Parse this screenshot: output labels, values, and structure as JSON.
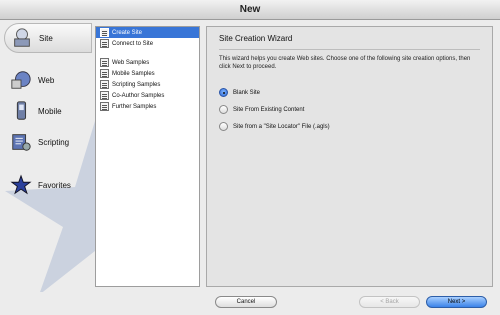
{
  "window": {
    "title": "New"
  },
  "categories": [
    {
      "label": "Site",
      "icon": "site-icon",
      "selected": true
    },
    {
      "label": "Web",
      "icon": "web-icon",
      "selected": false
    },
    {
      "label": "Mobile",
      "icon": "mobile-icon",
      "selected": false
    },
    {
      "label": "Scripting",
      "icon": "scripting-icon",
      "selected": false
    },
    {
      "label": "Favorites",
      "icon": "favorites-star-icon",
      "selected": false
    }
  ],
  "subitems": [
    {
      "label": "Create Site",
      "selected": true
    },
    {
      "label": "Connect to Site",
      "selected": false
    },
    {
      "label": "Web Samples",
      "selected": false
    },
    {
      "label": "Mobile Samples",
      "selected": false
    },
    {
      "label": "Scripting Samples",
      "selected": false
    },
    {
      "label": "Co-Author Samples",
      "selected": false
    },
    {
      "label": "Further Samples",
      "selected": false
    }
  ],
  "panel": {
    "title": "Site Creation Wizard",
    "description": "This wizard helps you create Web sites. Choose one of the following site creation options, then click Next to proceed.",
    "options": [
      {
        "label": "Blank Site",
        "checked": true
      },
      {
        "label": "Site From Existing Content",
        "checked": false
      },
      {
        "label": "Site from a \"Site Locator\" File (.agls)",
        "checked": false
      }
    ]
  },
  "buttons": {
    "cancel": "Cancel",
    "back": "< Back",
    "next": "Next >",
    "back_enabled": false
  },
  "colors": {
    "selection": "#3875d7",
    "default_button": "#3a82e8"
  }
}
